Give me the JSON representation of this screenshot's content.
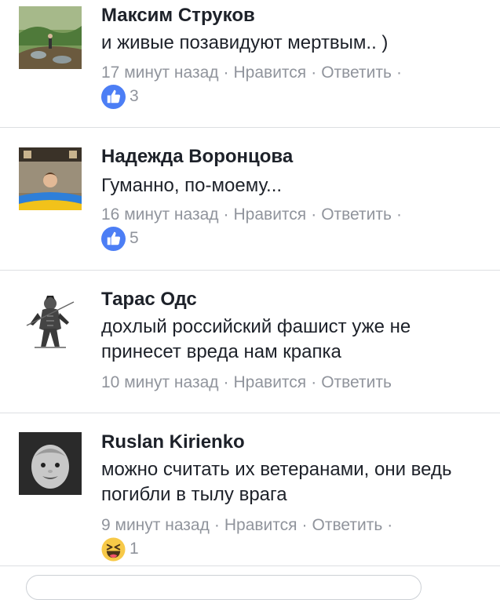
{
  "comments": [
    {
      "name": "Максим Струков",
      "text": "и живые позавидуют мертвым.. )",
      "time": "17 минут назад",
      "like_label": "Нравится",
      "reply_label": "Ответить",
      "reaction": {
        "icon": "like-icon",
        "count": "3"
      }
    },
    {
      "name": "Надежда Воронцова",
      "text": "Гуманно, по-моему...",
      "time": "16 минут назад",
      "like_label": "Нравится",
      "reply_label": "Ответить",
      "reaction": {
        "icon": "like-icon",
        "count": "5"
      }
    },
    {
      "name": "Тарас Одс",
      "text": "дохлый российский фашист уже не принесет вреда нам крапка",
      "time": "10 минут назад",
      "like_label": "Нравится",
      "reply_label": "Ответить"
    },
    {
      "name": "Ruslan Kirienko",
      "text": "можно считать их ветеранами, они ведь погибли в тылу врага",
      "time": "9 минут назад",
      "like_label": "Нравится",
      "reply_label": "Ответить",
      "reaction": {
        "icon": "haha-icon",
        "count": "1"
      }
    }
  ],
  "colors": {
    "like_blue": "#4c7ef5",
    "meta_gray": "#90949c",
    "text_dark": "#1d2129",
    "divider": "#dddfe2"
  }
}
